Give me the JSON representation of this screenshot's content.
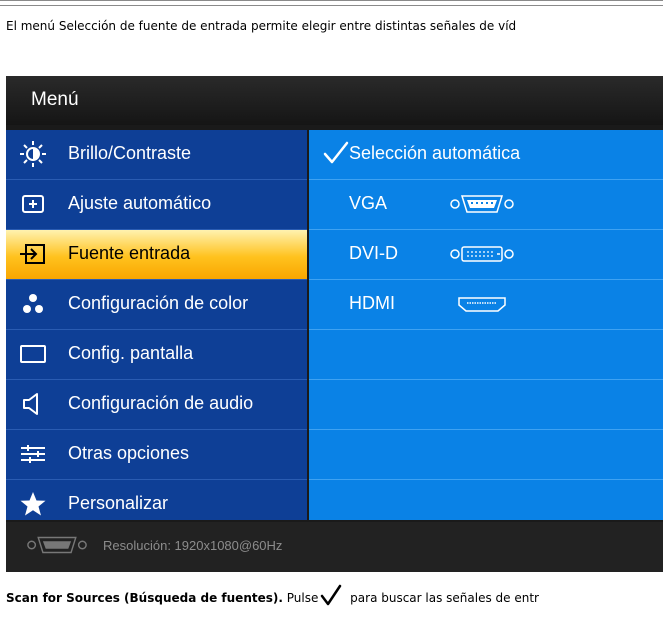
{
  "intro_text": "El menú Selección de fuente de entrada permite elegir entre distintas señales de víd",
  "osd": {
    "title": "Menú",
    "menu": [
      {
        "label": "Brillo/Contraste",
        "icon": "brightness-icon"
      },
      {
        "label": "Ajuste automático",
        "icon": "auto-adjust-icon"
      },
      {
        "label": "Fuente entrada",
        "icon": "input-source-icon",
        "selected": true
      },
      {
        "label": "Configuración de color",
        "icon": "color-dots-icon"
      },
      {
        "label": "Config. pantalla",
        "icon": "display-icon"
      },
      {
        "label": "Configuración de audio",
        "icon": "speaker-icon"
      },
      {
        "label": "Otras opciones",
        "icon": "sliders-icon"
      },
      {
        "label": "Personalizar",
        "icon": "star-icon"
      }
    ],
    "submenu": [
      {
        "label": "Selección automática",
        "checked": true
      },
      {
        "label": "VGA",
        "icon": "vga-connector-icon"
      },
      {
        "label": "DVI-D",
        "icon": "dvi-connector-icon"
      },
      {
        "label": "HDMI",
        "icon": "hdmi-connector-icon"
      }
    ],
    "footer": {
      "resolution": "Resolución:  1920x1080@60Hz",
      "icon": "vga-connector-icon"
    }
  },
  "bottom": {
    "bold": "Scan for Sources (Búsqueda de fuentes).",
    "pre": " Pulse",
    "post": " para buscar las señales de entr"
  },
  "colors": {
    "menu_bg": "#0e3f96",
    "submenu_bg": "#0a82e6",
    "highlight": "#ffc21e",
    "osd_bg": "#1a1a1a"
  }
}
